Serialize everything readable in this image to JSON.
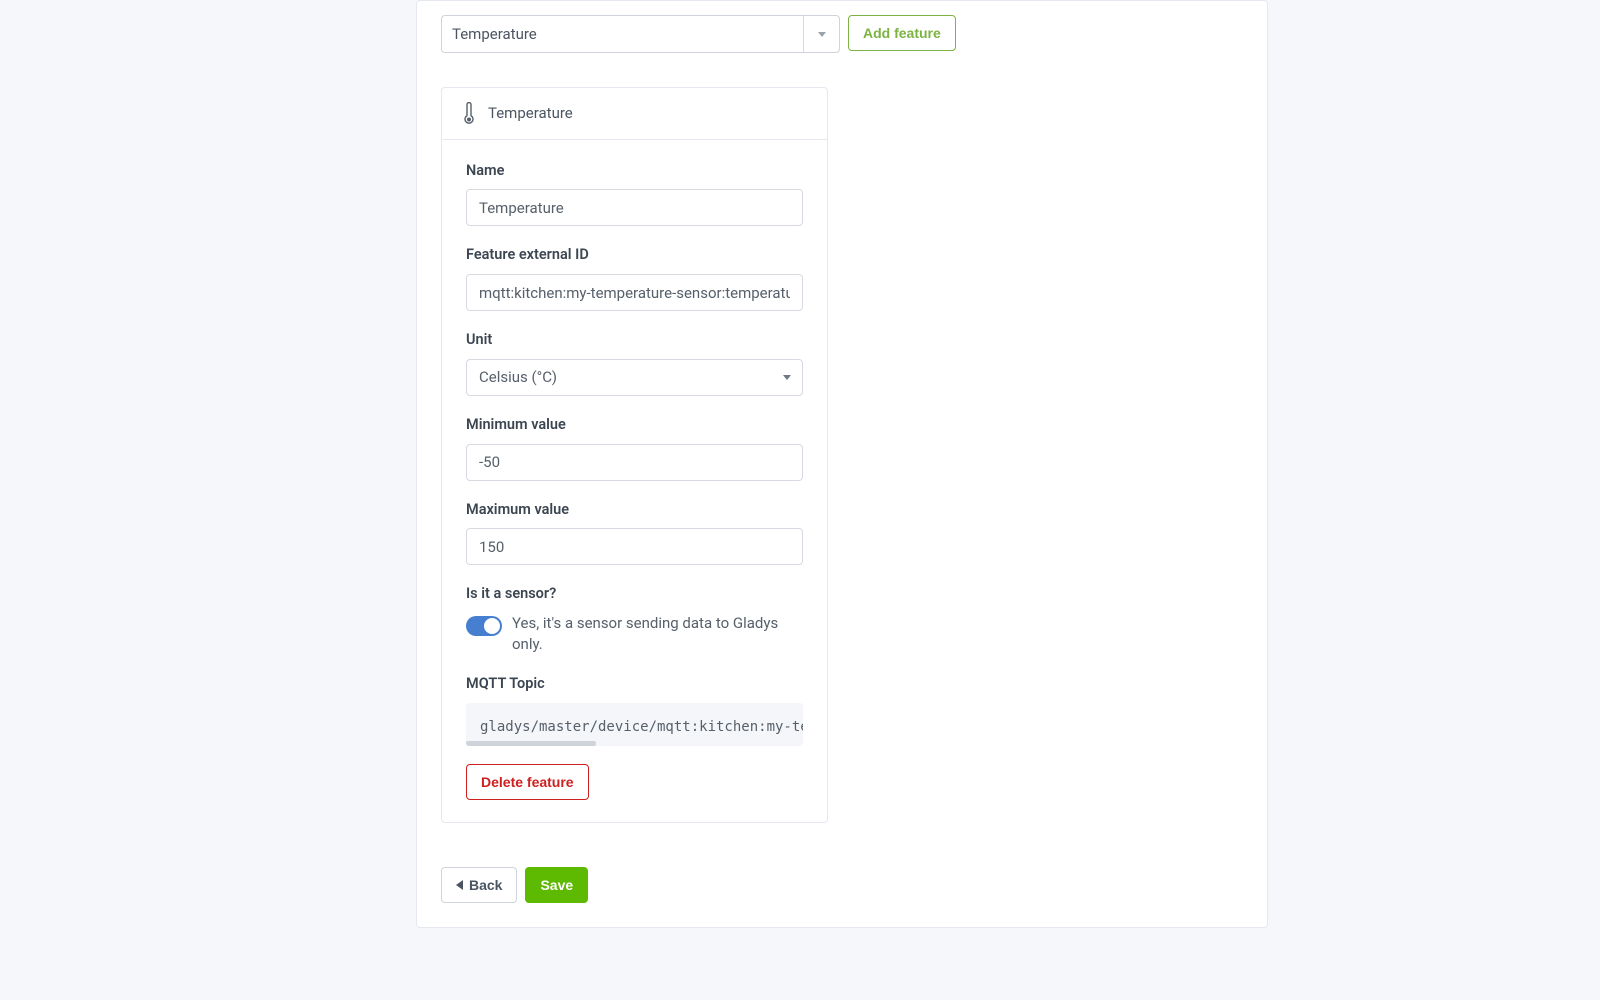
{
  "top": {
    "feature_select_value": "Temperature",
    "add_feature_label": "Add feature"
  },
  "card": {
    "title": "Temperature",
    "icon_name": "thermometer-icon",
    "labels": {
      "name": "Name",
      "external_id": "Feature external ID",
      "unit": "Unit",
      "min": "Minimum value",
      "max": "Maximum value",
      "is_sensor": "Is it a sensor?",
      "mqtt_topic": "MQTT Topic"
    },
    "values": {
      "name": "Temperature",
      "external_id": "mqtt:kitchen:my-temperature-sensor:temperatu",
      "unit": "Celsius (°C)",
      "min": "-50",
      "max": "150",
      "sensor_desc": "Yes, it's a sensor sending data to Gladys only.",
      "mqtt_topic": "gladys/master/device/mqtt:kitchen:my-tempera"
    },
    "delete_label": "Delete feature"
  },
  "footer": {
    "back_label": "Back",
    "save_label": "Save"
  },
  "colors": {
    "accent_green": "#5eba00",
    "outline_green": "#7cb342",
    "danger": "#cd201f",
    "toggle_blue": "#467fcf"
  }
}
